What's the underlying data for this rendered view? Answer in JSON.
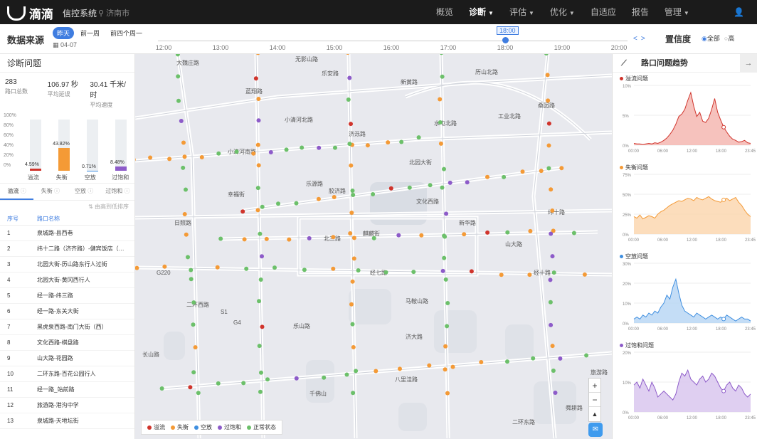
{
  "topbar": {
    "logo_text": "滴滴",
    "system_title": "信控系统",
    "location": "济南市",
    "nav": [
      {
        "label": "概览",
        "caret": false,
        "active": false
      },
      {
        "label": "诊断",
        "caret": true,
        "active": true
      },
      {
        "label": "评估",
        "caret": true,
        "active": false
      },
      {
        "label": "优化",
        "caret": true,
        "active": false
      },
      {
        "label": "自适应",
        "caret": false,
        "active": false
      },
      {
        "label": "报告",
        "caret": false,
        "active": false
      },
      {
        "label": "管理",
        "caret": true,
        "active": false
      }
    ]
  },
  "timebar": {
    "source_label": "数据来源",
    "periods": [
      "昨天",
      "前一周",
      "前四个周一"
    ],
    "selected_period": "昨天",
    "date": "04-07",
    "ticks": [
      "12:00",
      "13:00",
      "14:00",
      "15:00",
      "16:00",
      "17:00",
      "18:00",
      "19:00",
      "20:00"
    ],
    "current_time": "18:00",
    "confidence_label": "置信度",
    "confidence_options": [
      "全部",
      "高"
    ],
    "confidence_selected": "全部"
  },
  "left_panel": {
    "title": "诊断问题",
    "stats": [
      {
        "value": "283",
        "label": "路口总数"
      },
      {
        "value": "106.97 秒",
        "label": "平均延误"
      },
      {
        "value": "30.41 千米/时",
        "label": "平均速度"
      }
    ],
    "y_ticks": [
      "100%",
      "80%",
      "60%",
      "40%",
      "20%",
      "0%"
    ],
    "bars": [
      {
        "label": "溢流",
        "value": "4.59%",
        "pct": 4.59,
        "color": "#d0342c"
      },
      {
        "label": "失衡",
        "value": "43.82%",
        "pct": 43.82,
        "color": "#f49a36"
      },
      {
        "label": "空放",
        "value": "0.71%",
        "pct": 0.71,
        "color": "#3f8fe0"
      },
      {
        "label": "过饱和",
        "value": "8.48%",
        "pct": 8.48,
        "color": "#8d5bc9"
      }
    ],
    "tabs": [
      "溢流",
      "失衡",
      "空放",
      "过饱和"
    ],
    "active_tab": "溢流",
    "sort_hint": "由高到低排序",
    "table_headers": [
      "序号",
      "路口名称"
    ],
    "rows": [
      {
        "no": "1",
        "name": "泉城路-县西巷"
      },
      {
        "no": "2",
        "name": "纬十二路（济齐路）-健宾饭店（堤…"
      },
      {
        "no": "3",
        "name": "北园大街-历山路东行人过街"
      },
      {
        "no": "4",
        "name": "北园大街-黄冈西行人"
      },
      {
        "no": "5",
        "name": "经一路-纬三路"
      },
      {
        "no": "6",
        "name": "经一路-东关大街"
      },
      {
        "no": "7",
        "name": "黑虎泉西路-南门大街（西）"
      },
      {
        "no": "8",
        "name": "文化西路-棋盘路"
      },
      {
        "no": "9",
        "name": "山大路-花园路"
      },
      {
        "no": "10",
        "name": "二环东路-百花公园行人"
      },
      {
        "no": "11",
        "name": "经一路_站前路"
      },
      {
        "no": "12",
        "name": "旅游路-港沟中学"
      },
      {
        "no": "13",
        "name": "泉城路-天地坛街"
      }
    ]
  },
  "map": {
    "road_labels": [
      "大魏庄路",
      "无影山路",
      "乐安路",
      "新黄路",
      "历山北路",
      "蓝翔路",
      "小清河北路",
      "水屯北路",
      "工业北路",
      "济泺路",
      "小清河南路",
      "北园大街",
      "桑园路",
      "幸福街",
      "乐源路",
      "胶济路",
      "日照路",
      "纬十路",
      "北三路",
      "麒麟街",
      "新华路",
      "经十路",
      "文化西路",
      "二环西路",
      "马鞍山路",
      "乐山路",
      "济大路",
      "二环东路",
      "八里洼路",
      "舜耕路",
      "旅游路",
      "长山路",
      "经七路",
      "山大路",
      "千佛山",
      "G220",
      "G4",
      "S1"
    ],
    "legend": [
      {
        "label": "溢流",
        "color": "#d0342c"
      },
      {
        "label": "失衡",
        "color": "#f49a36"
      },
      {
        "label": "空放",
        "color": "#3f8fe0"
      },
      {
        "label": "过饱和",
        "color": "#8d5bc9"
      },
      {
        "label": "正常状态",
        "color": "#6cc06a"
      }
    ]
  },
  "right_panel": {
    "title": "路口问题趋势",
    "x_ticks": [
      "00:00",
      "06:00",
      "12:00",
      "18:00",
      "23:45"
    ],
    "charts": [
      {
        "title": "溢流问题",
        "color": "#d0342c",
        "fill": "#f4b3ac",
        "y_ticks": [
          "10%",
          "5%",
          "0%"
        ],
        "ymax": 10,
        "values": [
          0.3,
          0.2,
          0.2,
          0.1,
          0.2,
          0.3,
          0.2,
          0.4,
          0.3,
          0.5,
          0.8,
          1.2,
          1.8,
          2.5,
          3.5,
          4.8,
          5.2,
          6.0,
          7.5,
          8.8,
          6.5,
          4.8,
          5.5,
          4.0,
          3.8,
          4.5,
          6.0,
          7.8,
          5.5,
          4.2,
          3.0,
          2.2,
          1.5,
          1.0,
          0.8,
          0.5,
          0.6,
          0.8,
          0.4,
          0.3
        ]
      },
      {
        "title": "失衡问题",
        "color": "#f49a36",
        "fill": "#fbd5ab",
        "y_ticks": [
          "75%",
          "50%",
          "25%",
          "0%"
        ],
        "ymax": 75,
        "values": [
          22,
          20,
          24,
          19,
          21,
          23,
          22,
          20,
          25,
          28,
          30,
          33,
          36,
          38,
          40,
          42,
          41,
          43,
          45,
          44,
          42,
          46,
          44,
          43,
          45,
          47,
          44,
          42,
          41,
          40,
          43,
          45,
          42,
          44,
          46,
          40,
          36,
          30,
          25,
          22
        ]
      },
      {
        "title": "空放问题",
        "color": "#3f8fe0",
        "fill": "#b5d4f4",
        "y_ticks": [
          "30%",
          "20%",
          "10%",
          "0%"
        ],
        "ymax": 30,
        "values": [
          2,
          3,
          2,
          4,
          3,
          5,
          4,
          6,
          5,
          8,
          10,
          14,
          12,
          18,
          22,
          15,
          9,
          6,
          5,
          4,
          3,
          5,
          4,
          3,
          2,
          3,
          4,
          3,
          2,
          3,
          2,
          4,
          3,
          2,
          1,
          2,
          3,
          2,
          2,
          1
        ]
      },
      {
        "title": "过饱和问题",
        "color": "#8d5bc9",
        "fill": "#d7c3ee",
        "y_ticks": [
          "20%",
          "10%",
          "0%"
        ],
        "ymax": 20,
        "values": [
          9,
          10,
          8,
          11,
          9,
          7,
          10,
          8,
          5,
          6,
          7,
          6,
          5,
          4,
          6,
          10,
          13,
          12,
          14,
          11,
          10,
          9,
          11,
          12,
          10,
          11,
          13,
          12,
          10,
          8,
          7,
          9,
          10,
          8,
          7,
          9,
          8,
          6,
          5,
          6
        ]
      }
    ]
  }
}
